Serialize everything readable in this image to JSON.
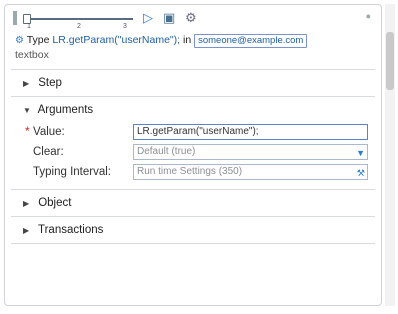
{
  "toolbar": {
    "slider_ticks": [
      "1",
      "2",
      "3"
    ],
    "slider_value": 1,
    "icons": [
      "grip-icon",
      "play-icon",
      "record-icon",
      "tool-icon",
      "pin-icon"
    ]
  },
  "summary": {
    "type_label": "Type",
    "code": "LR.getParam(\"userName\");",
    "in_label": "in",
    "email": "someone@example.com",
    "trailing": "textbox"
  },
  "sections": {
    "step": "Step",
    "arguments": "Arguments",
    "object": "Object",
    "transactions": "Transactions"
  },
  "arguments": {
    "value_label": "Value:",
    "value": "LR.getParam(\"userName\");",
    "clear_label": "Clear:",
    "clear_value": "Default (true)",
    "interval_label": "Typing Interval:",
    "interval_value": "Run time Settings (350)"
  },
  "colors": {
    "accent": "#2b7bd1",
    "required": "#dd2222"
  }
}
